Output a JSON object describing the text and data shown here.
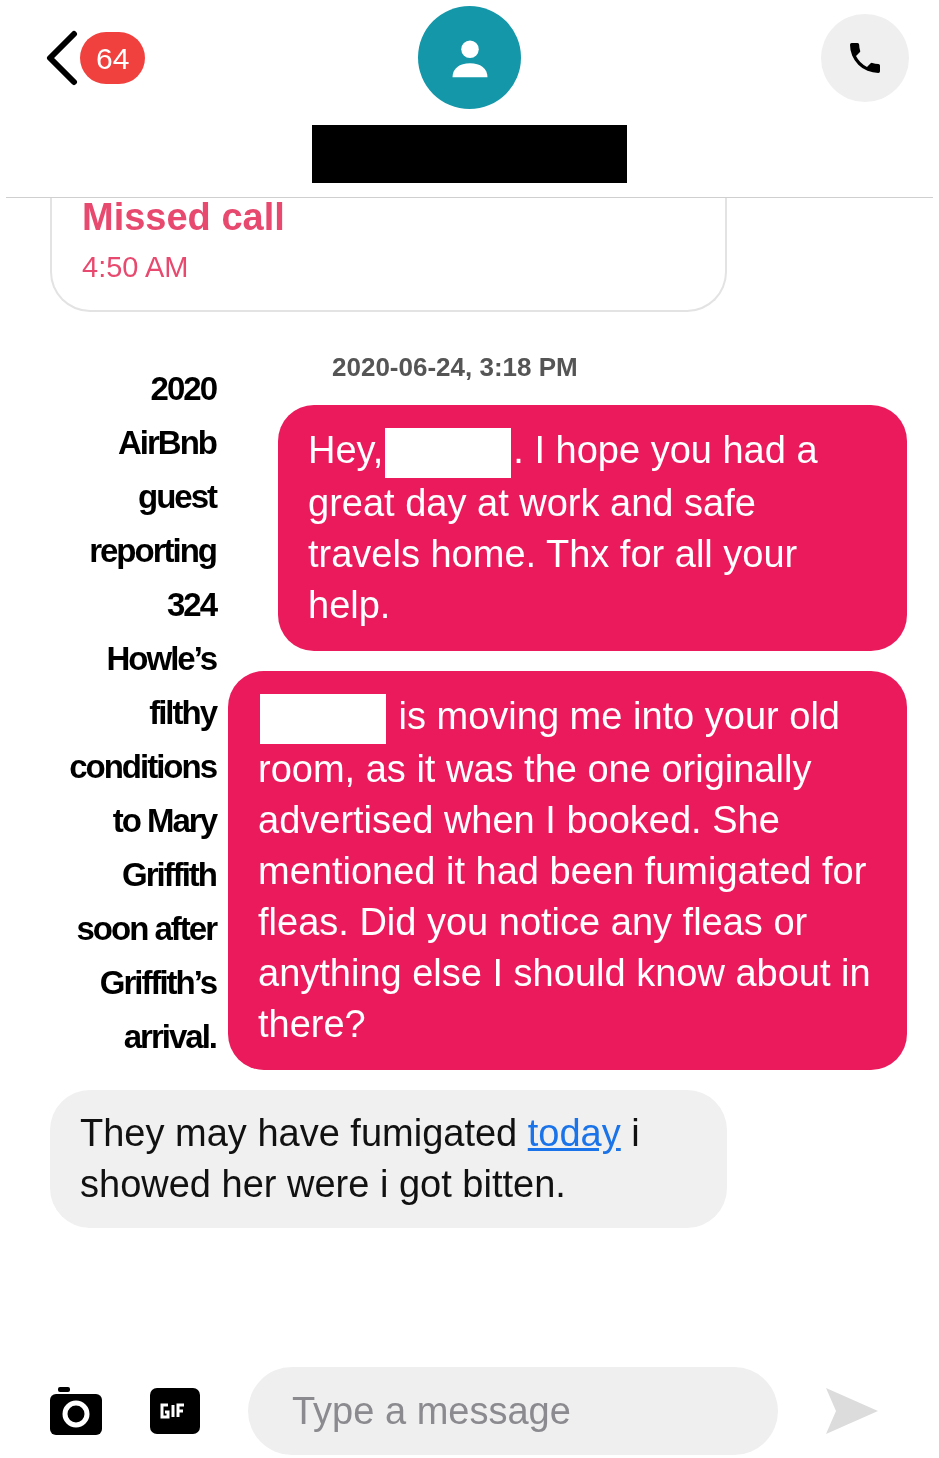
{
  "header": {
    "unread_count": "64"
  },
  "missed_call": {
    "title": "Missed call",
    "time": "4:50 AM"
  },
  "annotation": "2020 AirBnb guest reporting 324 Howle’s filthy conditions to Mary Griffith soon after Griffith’s arrival.",
  "timestamp": "2020-06-24, 3:18 PM",
  "messages": [
    {
      "kind": "outgoing",
      "segments": [
        {
          "kind": "text",
          "text": "Hey,"
        },
        {
          "kind": "redacted"
        },
        {
          "kind": "text",
          "text": ". I hope you had a great day at work and safe travels home. Thx for all your help."
        }
      ]
    },
    {
      "kind": "outgoing",
      "segments": [
        {
          "kind": "redacted"
        },
        {
          "kind": "text",
          "text": " is moving me into your old room, as it was the one originally advertised when I booked. She mentioned it had been fumigated for fleas. Did you notice any fleas or anything else I should know about in there?"
        }
      ]
    },
    {
      "kind": "incoming",
      "segments": [
        {
          "kind": "text",
          "text": "They may have fumigated "
        },
        {
          "kind": "link",
          "text": "today"
        },
        {
          "kind": "text",
          "text": " i showed her were i got bitten."
        }
      ]
    }
  ],
  "composer": {
    "placeholder": "Type a message"
  }
}
